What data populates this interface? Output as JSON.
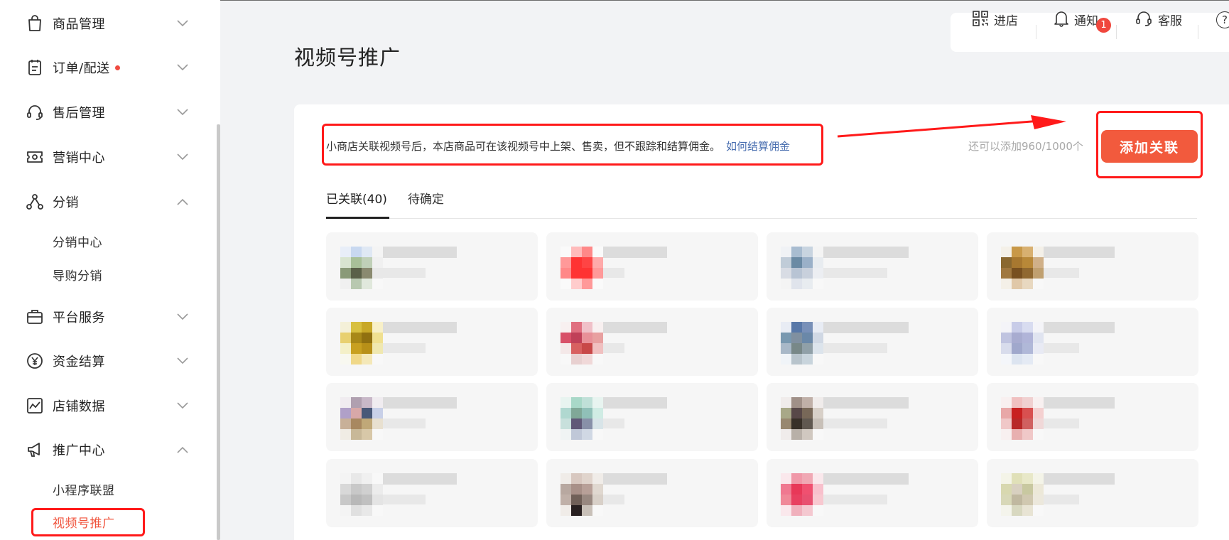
{
  "sidebar": {
    "items": [
      {
        "label": "商品管理",
        "icon": "shopping-bag-icon",
        "expanded": false
      },
      {
        "label": "订单/配送",
        "icon": "order-list-icon",
        "expanded": false,
        "has_dot": true
      },
      {
        "label": "售后管理",
        "icon": "headset-icon",
        "expanded": false
      },
      {
        "label": "营销中心",
        "icon": "ticket-icon",
        "expanded": false
      },
      {
        "label": "分销",
        "icon": "share-nodes-icon",
        "expanded": true,
        "children": [
          "分销中心",
          "导购分销"
        ]
      },
      {
        "label": "平台服务",
        "icon": "briefcase-icon",
        "expanded": false
      },
      {
        "label": "资金结算",
        "icon": "yuan-circle-icon",
        "expanded": false
      },
      {
        "label": "店铺数据",
        "icon": "chart-frame-icon",
        "expanded": false
      },
      {
        "label": "推广中心",
        "icon": "megaphone-icon",
        "expanded": true,
        "children": [
          "小程序联盟",
          "视频号推广"
        ],
        "active_child": "视频号推广"
      }
    ]
  },
  "page": {
    "title": "视频号推广"
  },
  "toolbar": {
    "enter_store": "进店",
    "notify": "通知",
    "notify_badge": "1",
    "service": "客服",
    "help": "?"
  },
  "notice": {
    "text": "小商店关联视频号后，本店商品可在该视频号中上架、售卖，但不跟踪和结算佣金。",
    "link": "如何结算佣金"
  },
  "quota_text": "还可以添加960/1000个",
  "add_button": "添加关联",
  "tabs": [
    {
      "label": "已关联(40)",
      "active": true
    },
    {
      "label": "待确定",
      "active": false
    }
  ],
  "colors": {
    "accent": "#f25a3d",
    "annotation": "#ff1a1a",
    "link": "#4a6fb0"
  },
  "grid_items": [
    {
      "thumb": [
        "#e8eef8",
        "#c8d8f0",
        "#dfe8f4",
        "#f4f4f4",
        "#d8e4d0",
        "#a8c098",
        "#c0d0b8",
        "#f0f0f0",
        "#8a9a78",
        "#5a6048",
        "#8a8a70",
        "#e8e8e8",
        "#f0f0f0",
        "#b8c8b0",
        "#e0e8dc",
        "#f8f8f8"
      ]
    },
    {
      "thumb": [
        "#fafafa",
        "#fbb",
        "#f88",
        "#fafafa",
        "#f99",
        "#f33",
        "#f44",
        "#faa",
        "#f88",
        "#f33",
        "#f33",
        "#f99",
        "#fafafa",
        "#fcc",
        "#f99",
        "#fafafa"
      ]
    },
    {
      "thumb": [
        "#f0f2f5",
        "#a8bcd0",
        "#c8d4e0",
        "#f4f4f4",
        "#c0ccd8",
        "#6a8aa4",
        "#9ab0c8",
        "#e8ecf0",
        "#d8dce4",
        "#b8c4d4",
        "#c8d0dc",
        "#eceef2",
        "#f4f4f4",
        "#e0e4ec",
        "#e8ecf0",
        "#f8f8f8"
      ]
    },
    {
      "thumb": [
        "#f4f0e8",
        "#c89848",
        "#d8b070",
        "#f4f0e8",
        "#8a6830",
        "#a87830",
        "#b88838",
        "#d0b088",
        "#a07840",
        "#785020",
        "#906830",
        "#c0a070",
        "#f4f0e8",
        "#e0c8a8",
        "#e8d8c0",
        "#f8f8f8"
      ]
    },
    {
      "thumb": [
        "#f4f0d8",
        "#d8c040",
        "#c8a828",
        "#f8f0c8",
        "#e8d070",
        "#a88818",
        "#907010",
        "#f0e090",
        "#f4f0c8",
        "#c8a020",
        "#b89018",
        "#f0e8b0",
        "#f8f8f0",
        "#f0d888",
        "#f4e8b8",
        "#f8f8f8"
      ]
    },
    {
      "thumb": [
        "#f8f0f0",
        "#e07080",
        "#f0c0c8",
        "#f8f0f0",
        "#d85068",
        "#c04058",
        "#e89098",
        "#e8a0a0",
        "#f4e8e8",
        "#d86060",
        "#c84848",
        "#f0c0c0",
        "#f8f8f8",
        "#e8d0d0",
        "#f0d8d8",
        "#f8f8f8"
      ]
    },
    {
      "thumb": [
        "#e8ecf4",
        "#5878a8",
        "#7890b8",
        "#e8ecf4",
        "#7898b0",
        "#8090a0",
        "#6a88a8",
        "#d0d8e4",
        "#a8b8c8",
        "#788888",
        "#90a0a8",
        "#dce4ec",
        "#f0f4f8",
        "#b8c4cc",
        "#c8d4dc",
        "#f8f8f8"
      ]
    },
    {
      "thumb": [
        "#f4f4f8",
        "#c8cce8",
        "#d8dcf0",
        "#f4f4f8",
        "#c0c4e0",
        "#a8acd0",
        "#b0b4d8",
        "#e0e4f0",
        "#d8dcec",
        "#a0a8cc",
        "#b0b8d8",
        "#e8eaf4",
        "#f4f6fa",
        "#dce4f0",
        "#e4eaf4",
        "#f8f8f8"
      ]
    },
    {
      "thumb": [
        "#f0ecf0",
        "#b0a0b0",
        "#c8b8c8",
        "#f0ecf0",
        "#b0a0c8",
        "#d8a8a8",
        "#485878",
        "#c8d0e8",
        "#c8b098",
        "#a88860",
        "#c0a878",
        "#e8e0d0",
        "#f0ece4",
        "#c8b898",
        "#d8c8a8",
        "#f8f8f8"
      ]
    },
    {
      "thumb": [
        "#e8f4f0",
        "#a8d8c8",
        "#c0e0d8",
        "#e8f4f0",
        "#b0d8d0",
        "#80a898",
        "#90c0b8",
        "#d0ece4",
        "#c8e0dc",
        "#605878",
        "#8890a8",
        "#d8e4e8",
        "#f0f4f4",
        "#c0c8d8",
        "#d0d8e4",
        "#f8f8f8"
      ]
    },
    {
      "thumb": [
        "#f0eceb",
        "#a09088",
        "#c0b0a8",
        "#f0eceb",
        "#a8a888",
        "#584848",
        "#786858",
        "#d8d0c8",
        "#988870",
        "#383028",
        "#605850",
        "#c8c0b8",
        "#f0eceb",
        "#b8b0a8",
        "#d0c8c0",
        "#f8f8f8"
      ]
    },
    {
      "thumb": [
        "#f8f0f0",
        "#f0c0c0",
        "#f0d0d0",
        "#f8f0f0",
        "#e8a8a8",
        "#c82020",
        "#d85050",
        "#f4d0d0",
        "#f0c8c8",
        "#b82828",
        "#d06060",
        "#f0d8d8",
        "#f8f0f0",
        "#e8b0b0",
        "#f0c8c8",
        "#f8f8f8"
      ]
    },
    {
      "thumb": [
        "#f4f4f4",
        "#e8e8e8",
        "#f0f0f0",
        "#f8f8f8",
        "#d8d8d8",
        "#c8c8c8",
        "#d0d0d0",
        "#ececec",
        "#c8c8c8",
        "#b8b8b8",
        "#c0c0c0",
        "#e4e4e4",
        "#f4f4f4",
        "#e0e0e0",
        "#e8e8e8",
        "#f8f8f8"
      ]
    },
    {
      "thumb": [
        "#f0ece8",
        "#d8c8c0",
        "#e0d4cc",
        "#f0ece8",
        "#b8a8a0",
        "#a89088",
        "#b8a098",
        "#e0d8d0",
        "#c0b0a8",
        "#706058",
        "#988880",
        "#d8d0c8",
        "#f0ece8",
        "#282020",
        "#c8c0b8",
        "#f8f8f8"
      ]
    },
    {
      "thumb": [
        "#fae8ec",
        "#f098a8",
        "#f0a8b4",
        "#fae8ec",
        "#f07890",
        "#e83858",
        "#f05070",
        "#f8c0cc",
        "#f08898",
        "#e84060",
        "#e85070",
        "#f8c8d0",
        "#fae8ec",
        "#f0b0bc",
        "#f4c8d0",
        "#f8f8f8"
      ]
    },
    {
      "thumb": [
        "#f4f4e8",
        "#e0e0b8",
        "#e8e8c8",
        "#f4f4e8",
        "#d8d8b0",
        "#d8d0c0",
        "#c8c8a0",
        "#ece8d8",
        "#d8d8b8",
        "#c0b8a0",
        "#d0c8b0",
        "#ece8dc",
        "#f4f4ec",
        "#d8d8c0",
        "#e8e4d4",
        "#f8f8f8"
      ]
    }
  ]
}
